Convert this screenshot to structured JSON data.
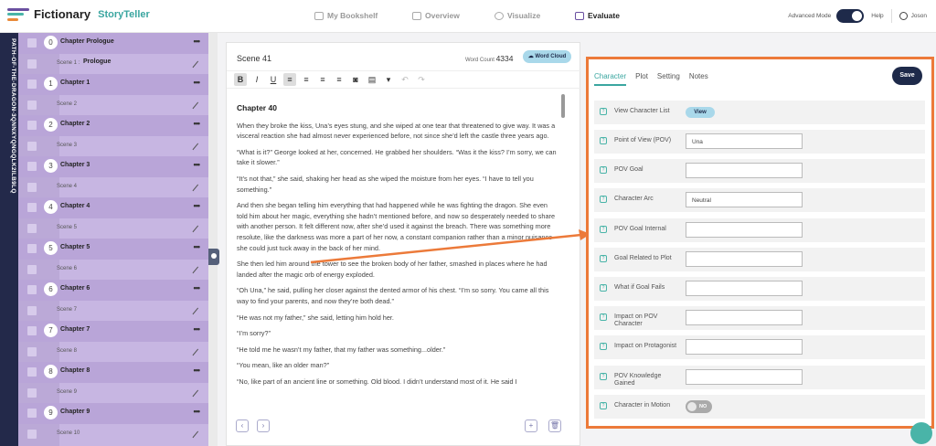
{
  "app": {
    "name": "Fictionary",
    "sub": "StoryTeller"
  },
  "nav": [
    {
      "label": "My Bookshelf"
    },
    {
      "label": "Overview"
    },
    {
      "label": "Visualize"
    },
    {
      "label": "Evaluate"
    }
  ],
  "top_right": {
    "advanced_label": "Advanced Mode",
    "help": "Help",
    "user": "Joson"
  },
  "book_title": "PATH-OF-THE-DRAGON-3QNNXYQNGQLK2ILB9LQ",
  "outline": [
    {
      "type": "chapter",
      "num": "0",
      "title": "Chapter Prologue"
    },
    {
      "type": "scene",
      "label": "Scene 1 :",
      "name": "Prologue"
    },
    {
      "type": "chapter",
      "num": "1",
      "title": "Chapter 1"
    },
    {
      "type": "scene",
      "label": "Scene 2",
      "name": ""
    },
    {
      "type": "chapter",
      "num": "2",
      "title": "Chapter 2"
    },
    {
      "type": "scene",
      "label": "Scene 3",
      "name": ""
    },
    {
      "type": "chapter",
      "num": "3",
      "title": "Chapter 3"
    },
    {
      "type": "scene",
      "label": "Scene 4",
      "name": ""
    },
    {
      "type": "chapter",
      "num": "4",
      "title": "Chapter 4"
    },
    {
      "type": "scene",
      "label": "Scene 5",
      "name": ""
    },
    {
      "type": "chapter",
      "num": "5",
      "title": "Chapter 5"
    },
    {
      "type": "scene",
      "label": "Scene 6",
      "name": ""
    },
    {
      "type": "chapter",
      "num": "6",
      "title": "Chapter 6"
    },
    {
      "type": "scene",
      "label": "Scene 7",
      "name": ""
    },
    {
      "type": "chapter",
      "num": "7",
      "title": "Chapter 7"
    },
    {
      "type": "scene",
      "label": "Scene 8",
      "name": ""
    },
    {
      "type": "chapter",
      "num": "8",
      "title": "Chapter 8"
    },
    {
      "type": "scene",
      "label": "Scene 9",
      "name": ""
    },
    {
      "type": "chapter",
      "num": "9",
      "title": "Chapter 9"
    },
    {
      "type": "scene",
      "label": "Scene 10",
      "name": ""
    }
  ],
  "editor": {
    "scene_title": "Scene 41",
    "word_count_label": "Word Count",
    "word_count": "4334",
    "word_cloud": "Word Cloud",
    "chapter_heading": "Chapter 40",
    "paragraphs": [
      "When they broke the kiss, Una’s eyes stung, and she wiped at one tear that threatened to give way. It was a visceral reaction she had almost never experienced before, not since she’d left the castle three years ago.",
      "“What is it?” George looked at her, concerned. He grabbed her shoulders. “Was it the kiss? I’m sorry, we can take it slower.”",
      "“It’s not that,” she said, shaking her head as she wiped the moisture from her eyes. “I have to tell you something.”",
      "And then she began telling him everything that had happened while he was fighting the dragon. She even told him about her magic, everything she hadn’t mentioned before, and now so desperately needed to share with another person. It felt different now, after she’d used it against the breach. There was something more resolute, like the darkness was more a part of her now, a constant companion rather than a minor nuisance she could just tuck away in the back of her mind.",
      "She then led him around the tower to see the broken body of her father, smashed in places where he had landed after the magic orb of energy exploded.",
      "“Oh Una,” he said, pulling her closer against the dented armor of his chest. “I’m so sorry. You came all this way to find your parents, and now they’re both dead.”",
      "“He was not my father,” she said, letting him hold her.",
      "“I’m sorry?”",
      "“He told me he wasn’t my father, that my father was something...older.”",
      "“You mean, like an older man?”",
      "“No, like part of an ancient line or something. Old blood. I didn’t understand most of it. He said I"
    ]
  },
  "panel": {
    "tabs": [
      "Character",
      "Plot",
      "Setting",
      "Notes"
    ],
    "save": "Save",
    "view_character_list": {
      "label": "View Character List",
      "button": "View"
    },
    "fields": [
      {
        "label": "Point of View (POV)",
        "value": "Una"
      },
      {
        "label": "POV Goal",
        "value": ""
      },
      {
        "label": "Character Arc",
        "value": "Neutral"
      },
      {
        "label": "POV Goal Internal",
        "value": ""
      },
      {
        "label": "Goal Related to Plot",
        "value": ""
      },
      {
        "label": "What if Goal Fails",
        "value": ""
      },
      {
        "label": "Impact on POV Character",
        "value": ""
      },
      {
        "label": "Impact on Protagonist",
        "value": ""
      },
      {
        "label": "POV Knowledge Gained",
        "value": ""
      }
    ],
    "motion": {
      "label": "Character in Motion",
      "toggle": "NO"
    }
  },
  "colors": {
    "accent": "#ec7a3a",
    "purple": "#c7b6e2",
    "navy": "#1e2a4a",
    "teal": "#3aa6a0"
  }
}
